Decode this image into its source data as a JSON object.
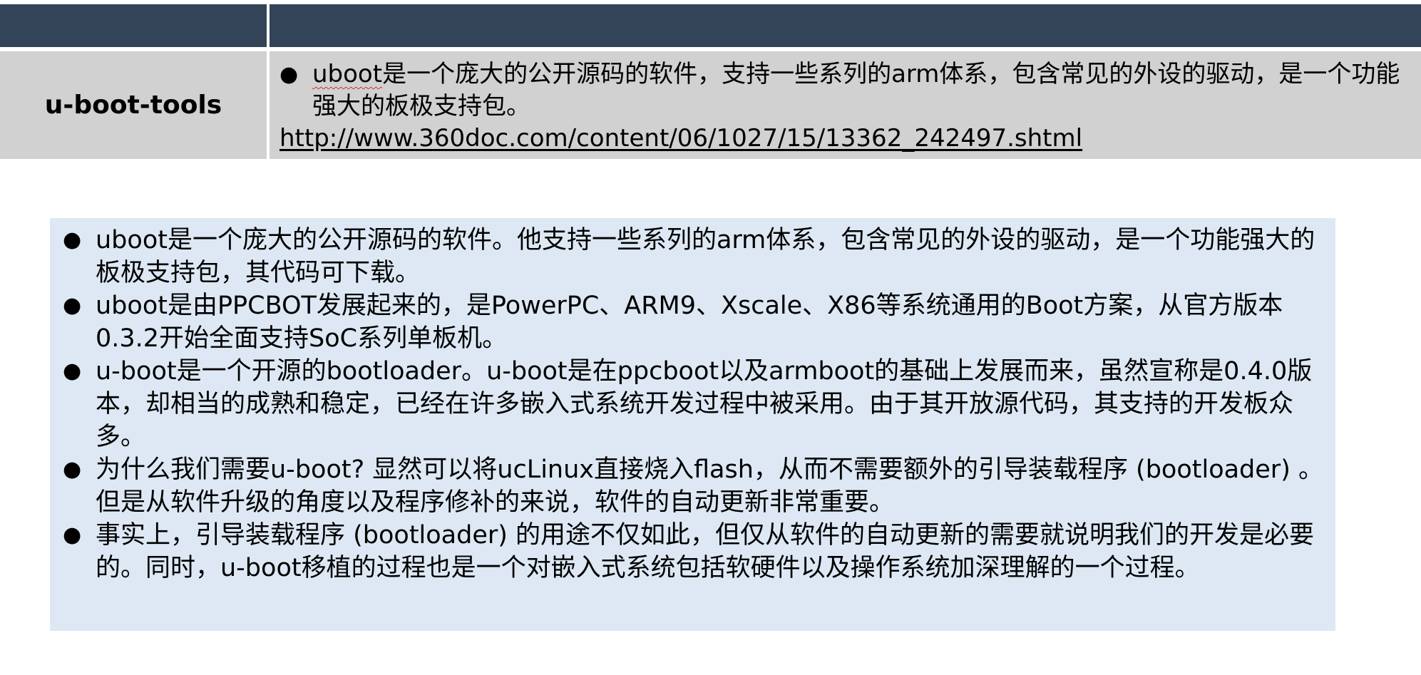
{
  "table": {
    "row_label": "u-boot-tools",
    "bullet": "uboot是一个庞大的公开源码的软件，支持一些系列的arm体系，包含常见的外设的驱动，是一个功能强大的板极支持包。",
    "bullet_word": "uboot",
    "bullet_rest": "是一个庞大的公开源码的软件，支持一些系列的arm体系，包含常见的外设的驱动，是一个功能强大的板极支持包。",
    "link": "http://www.360doc.com/content/06/1027/15/13362_242497.shtml"
  },
  "box": {
    "items": [
      "uboot是一个庞大的公开源码的软件。他支持一些系列的arm体系，包含常见的外设的驱动，是一个功能强大的板极支持包，其代码可下载。",
      "uboot是由PPCBOT发展起来的，是PowerPC、ARM9、Xscale、X86等系统通用的Boot方案，从官方版本0.3.2开始全面支持SoC系列单板机。",
      "u-boot是一个开源的bootloader。u-boot是在ppcboot以及armboot的基础上发展而来，虽然宣称是0.4.0版本，却相当的成熟和稳定，已经在许多嵌入式系统开发过程中被采用。由于其开放源代码，其支持的开发板众多。",
      "为什么我们需要u-boot? 显然可以将ucLinux直接烧入flash，从而不需要额外的引导装载程序 (bootloader) 。但是从软件升级的角度以及程序修补的来说，软件的自动更新非常重要。",
      "事实上，引导装载程序 (bootloader) 的用途不仅如此，但仅从软件的自动更新的需要就说明我们的开发是必要的。同时，u-boot移植的过程也是一个对嵌入式系统包括软硬件以及操作系统加深理解的一个过程。"
    ]
  },
  "bullet_symbol": "●"
}
